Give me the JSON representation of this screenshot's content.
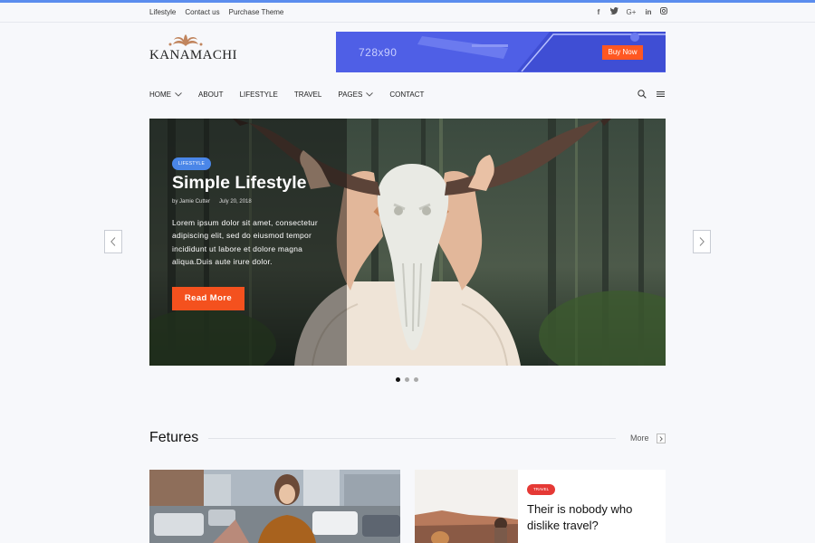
{
  "topbar": {
    "links": [
      "Lifestyle",
      "Contact us",
      "Purchase Theme"
    ],
    "social_icons": [
      "facebook-icon",
      "twitter-icon",
      "google-plus-icon",
      "linkedin-icon",
      "instagram-icon"
    ],
    "social_glyphs": [
      "f",
      "t",
      "G+",
      "in",
      "o"
    ]
  },
  "brand": {
    "name": "KANAMACHI",
    "accent": "#5b8dee"
  },
  "ad_banner": {
    "size_text": "728x90",
    "button_label": "Buy Now",
    "bg_color": "#4f5fe6",
    "button_color": "#ff5722"
  },
  "nav": {
    "items": [
      {
        "label": "HOME",
        "dropdown": true
      },
      {
        "label": "ABOUT",
        "dropdown": false
      },
      {
        "label": "LIFESTYLE",
        "dropdown": false
      },
      {
        "label": "TRAVEL",
        "dropdown": false
      },
      {
        "label": "PAGES",
        "dropdown": true
      },
      {
        "label": "CONTACT",
        "dropdown": false
      }
    ],
    "right_icons": [
      "search-icon",
      "menu-icon"
    ]
  },
  "hero": {
    "category": "LIFESTYLE",
    "title": "Simple Lifestyle",
    "author": "by Jamie Cutter",
    "date": "July 20, 2018",
    "excerpt": "Lorem ipsum dolor sit amet, consectetur adipiscing elit, sed do eiusmod tempor incididunt ut labore et dolore magna aliqua.Duis aute irure dolor.",
    "button_label": "Read More",
    "button_color": "#f4511e",
    "slides_total": 3,
    "active_slide": 1
  },
  "features": {
    "title": "Fetures",
    "more_label": "More",
    "cards": [
      {
        "tag": "",
        "title": ""
      },
      {
        "tag": "TRAVEL",
        "title": "Their is nobody who dislike travel?",
        "tag_color": "#e53935"
      }
    ]
  }
}
